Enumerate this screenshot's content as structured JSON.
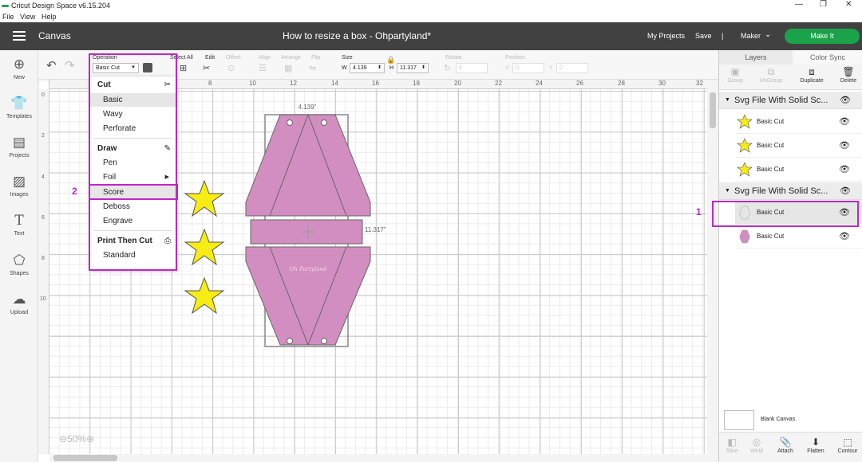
{
  "window": {
    "title": "Cricut Design Space  v6.15.204",
    "minimize": "—",
    "maximize": "❐",
    "close": "✕"
  },
  "menubar": [
    "File",
    "View",
    "Help"
  ],
  "header": {
    "section": "Canvas",
    "project_title": "How to resize a box - Ohpartyland*",
    "my_projects": "My Projects",
    "save": "Save",
    "separator": "|",
    "machine": "Maker",
    "make_it": "Make It"
  },
  "leftnav": [
    {
      "label": "New",
      "icon": "plus-circle-icon"
    },
    {
      "label": "Templates",
      "icon": "shirt-icon"
    },
    {
      "label": "Projects",
      "icon": "projects-icon"
    },
    {
      "label": "Images",
      "icon": "image-icon"
    },
    {
      "label": "Text",
      "icon": "text-icon"
    },
    {
      "label": "Shapes",
      "icon": "shapes-icon"
    },
    {
      "label": "Upload",
      "icon": "upload-icon"
    }
  ],
  "toolbar": {
    "operation_label": "Operation",
    "operation_value": "Basic Cut",
    "select_all": "Select All",
    "edit": "Edit",
    "offset": "Offset",
    "align": "Align",
    "arrange": "Arrange",
    "flip": "Flip",
    "size": "Size",
    "w_label": "W",
    "w_value": "4.139",
    "h_label": "H",
    "h_value": "11.317",
    "rotate": "Rotate",
    "rotate_value": "0",
    "position": "Position",
    "x_label": "X",
    "x_value": "0",
    "y_label": "Y",
    "y_value": "0"
  },
  "ruler_h": [
    "8",
    "10",
    "12",
    "14",
    "16",
    "18",
    "20",
    "22",
    "24",
    "26",
    "28",
    "30",
    "32"
  ],
  "ruler_v": [
    "0",
    "2",
    "4",
    "6",
    "8",
    "10"
  ],
  "operation_menu": {
    "cut_header": "Cut",
    "cut_items": [
      "Basic",
      "Wavy",
      "Perforate"
    ],
    "draw_header": "Draw",
    "draw_items": [
      "Pen",
      "Foil",
      "Score",
      "Deboss",
      "Engrave"
    ],
    "ptc_header": "Print Then Cut",
    "ptc_items": [
      "Standard"
    ]
  },
  "canvas": {
    "width_label": "4.139\"",
    "height_label": "11.317\"",
    "zoom": "50%",
    "watermark": "Oh Partyland"
  },
  "colors": {
    "accent": "#1aa34a",
    "box_fill": "#d28ec0",
    "star_fill": "#f7ec13",
    "highlight": "#c026c9",
    "header_bg": "#414141"
  },
  "right_panel": {
    "tabs": [
      "Layers",
      "Color Sync"
    ],
    "tools": [
      "Group",
      "UnGroup",
      "Duplicate",
      "Delete"
    ],
    "groups": [
      {
        "name": "Svg File With Solid Sc...",
        "layers": [
          "Basic Cut",
          "Basic Cut",
          "Basic Cut"
        ]
      },
      {
        "name": "Svg File With Solid Sc...",
        "layers": [
          "Basic Cut",
          "Basic Cut"
        ]
      }
    ],
    "blank_canvas": "Blank Canvas",
    "bottom_tools": [
      "Slice",
      "Weld",
      "Attach",
      "Flatten",
      "Contour"
    ]
  },
  "annotations": {
    "marker_1": "1",
    "marker_2": "2"
  }
}
